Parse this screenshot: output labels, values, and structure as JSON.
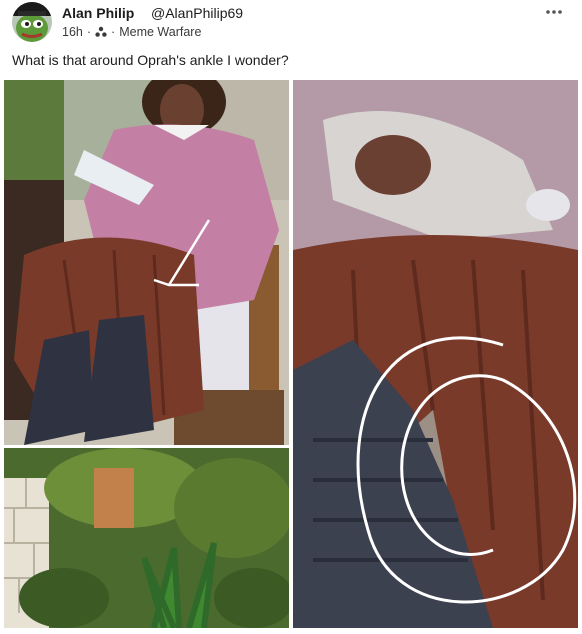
{
  "post": {
    "author_name": "Alan Philip",
    "author_handle": "@AlanPhilip69",
    "time_ago": "16h",
    "separator": "·",
    "community": "Meme Warfare",
    "text": "What is that around Oprah's ankle I wonder?"
  },
  "icons": {
    "more": "more-horizontal-icon",
    "community": "community-icon",
    "avatar": "pepe-avatar"
  },
  "colors": {
    "sweater": "#c47fa4",
    "skirt": "#7a3a2a",
    "boots": "#2f3240",
    "annotation": "#ffffff"
  }
}
